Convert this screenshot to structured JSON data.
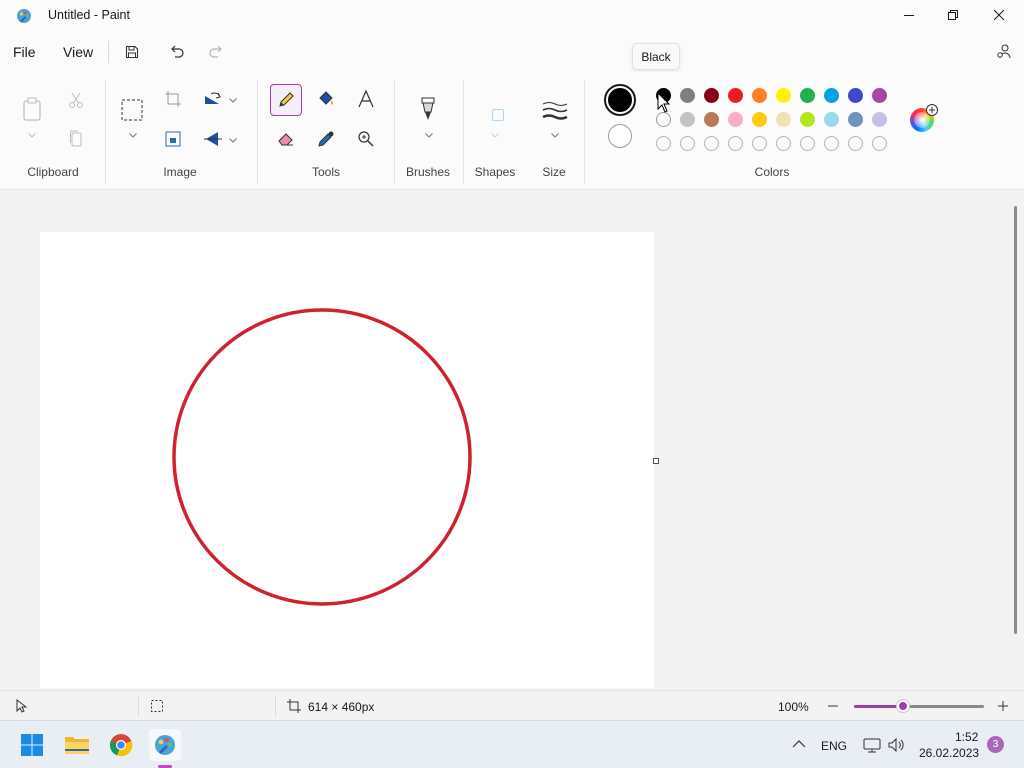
{
  "window": {
    "title": "Untitled - Paint"
  },
  "menu": {
    "file": "File",
    "view": "View"
  },
  "tooltip": "Black",
  "ribbon": {
    "groups": {
      "clipboard": "Clipboard",
      "image": "Image",
      "tools": "Tools",
      "brushes": "Brushes",
      "shapes": "Shapes",
      "size": "Size",
      "colors": "Colors"
    },
    "active_tool": "pencil"
  },
  "colors": {
    "primary": "#000000",
    "secondary": "#ffffff",
    "palette_row1": [
      "#000000",
      "#7f7f7f",
      "#880015",
      "#ed1c24",
      "#ff7f27",
      "#fff200",
      "#22b14c",
      "#00a2e8",
      "#3f48cc",
      "#a349a4"
    ],
    "palette_row2": [
      "#ffffff",
      "#c3c3c3",
      "#b97a57",
      "#ffaec9",
      "#ffc90e",
      "#efe4b0",
      "#b5e61d",
      "#99d9ea",
      "#7092be",
      "#c8bfe7"
    ],
    "palette_row3_empty_count": 10,
    "drawn_circle_stroke": "#d0222e",
    "accent": "#9c3fa6"
  },
  "canvas": {
    "drawing": "red circle outline"
  },
  "status": {
    "canvas_size": "614 × 460px",
    "zoom_level": "100%",
    "zoom_slider_fraction": 0.38
  },
  "taskbar": {
    "language": "ENG",
    "time": "1:52",
    "date": "26.02.2023",
    "notification_count": "3"
  }
}
